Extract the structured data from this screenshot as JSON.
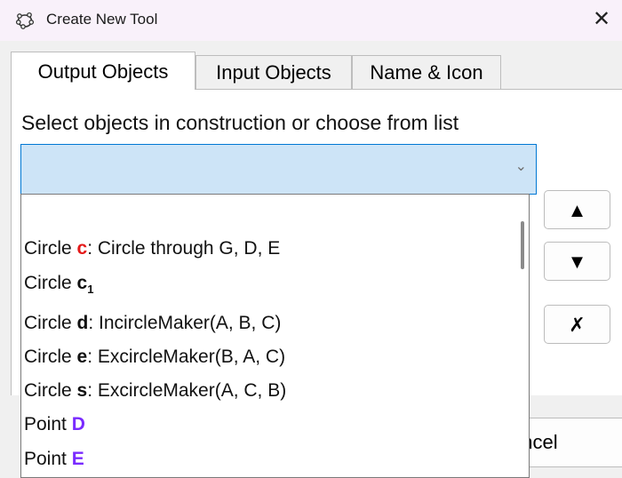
{
  "window": {
    "title": "Create New Tool",
    "close_glyph": "✕",
    "icon": "geogebra-tool-icon"
  },
  "tabs": [
    {
      "label": "Output Objects",
      "active": true
    },
    {
      "label": "Input Objects",
      "active": false
    },
    {
      "label": "Name & Icon",
      "active": false
    }
  ],
  "panel": {
    "caption": "Select objects in construction or choose from list",
    "combo_value": "",
    "combo_arrow": "⌄"
  },
  "side_buttons": {
    "up": "▲",
    "down": "▼",
    "remove": "✗"
  },
  "footer": {
    "cancel_label": "ancel"
  },
  "dropdown_items": [
    {
      "type": "Circle",
      "name": "c",
      "name_color": "#e41919",
      "sub": "",
      "definition": ": Circle through G, D, E"
    },
    {
      "type": "Circle",
      "name": "c",
      "name_color": "#000000",
      "sub": "1",
      "definition": ""
    },
    {
      "type": "Circle",
      "name": "d",
      "name_color": "#000000",
      "sub": "",
      "definition": ": IncircleMaker(A, B, C)"
    },
    {
      "type": "Circle",
      "name": "e",
      "name_color": "#000000",
      "sub": "",
      "definition": ": ExcircleMaker(B, A, C)"
    },
    {
      "type": "Circle",
      "name": "s",
      "name_color": "#000000",
      "sub": "",
      "definition": ": ExcircleMaker(A, C, B)"
    },
    {
      "type": "Point",
      "name": "D",
      "name_color": "#7a2bff",
      "sub": "",
      "definition": ""
    },
    {
      "type": "Point",
      "name": "E",
      "name_color": "#7a2bff",
      "sub": "",
      "definition": ""
    }
  ]
}
